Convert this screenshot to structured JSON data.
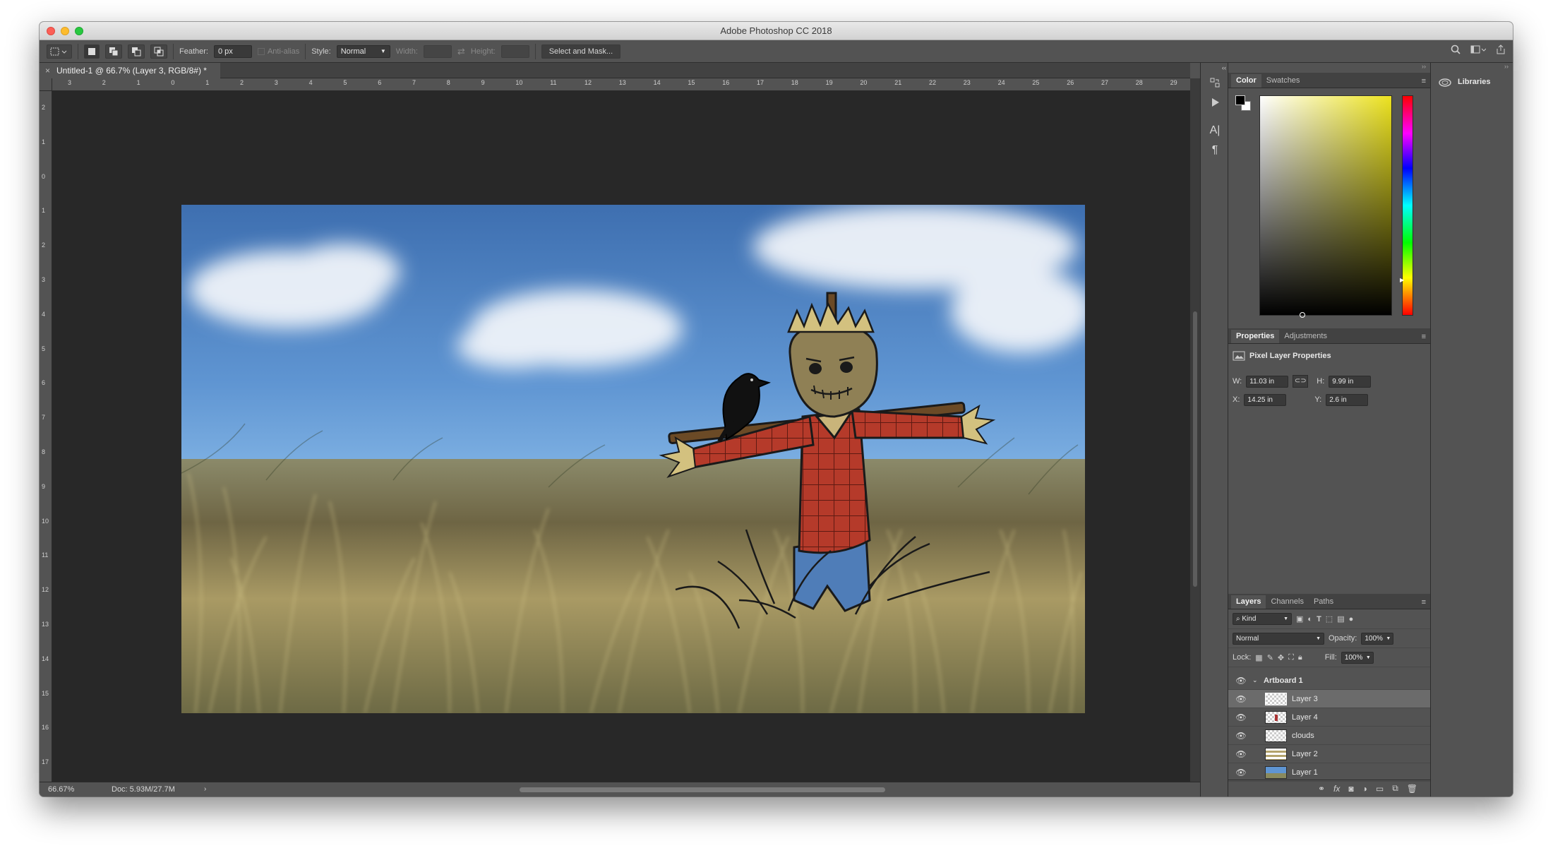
{
  "app": {
    "title": "Adobe Photoshop CC 2018"
  },
  "options_bar": {
    "feather_label": "Feather:",
    "feather_value": "0 px",
    "anti_alias_label": "Anti-alias",
    "style_label": "Style:",
    "style_value": "Normal",
    "width_label": "Width:",
    "height_label": "Height:",
    "select_mask_label": "Select and Mask..."
  },
  "document": {
    "tab_title": "Untitled-1 @ 66.7% (Layer 3, RGB/8#) *",
    "zoom": "66.67%",
    "doc_size": "Doc: 5.93M/27.7M"
  },
  "rulers": {
    "top": [
      "3",
      "2",
      "1",
      "0",
      "1",
      "2",
      "3",
      "4",
      "5",
      "6",
      "7",
      "8",
      "9",
      "10",
      "11",
      "12",
      "13",
      "14",
      "15",
      "16",
      "17",
      "18",
      "19",
      "20",
      "21",
      "22",
      "23",
      "24",
      "25",
      "26",
      "27",
      "28",
      "29"
    ],
    "left": [
      "2",
      "1",
      "0",
      "1",
      "2",
      "3",
      "4",
      "5",
      "6",
      "7",
      "8",
      "9",
      "10",
      "11",
      "12",
      "13",
      "14",
      "15",
      "16",
      "17"
    ]
  },
  "color_panel": {
    "tabs": [
      "Color",
      "Swatches"
    ],
    "foreground": "#000000",
    "background": "#ffffff",
    "hue_color": "#ece21f"
  },
  "properties_panel": {
    "tabs": [
      "Properties",
      "Adjustments"
    ],
    "heading": "Pixel Layer Properties",
    "w_label": "W:",
    "w_value": "11.03 in",
    "h_label": "H:",
    "h_value": "9.99 in",
    "x_label": "X:",
    "x_value": "14.25 in",
    "y_label": "Y:",
    "y_value": "2.6 in"
  },
  "layers_panel": {
    "tabs": [
      "Layers",
      "Channels",
      "Paths"
    ],
    "filter_value": "Kind",
    "blend_mode": "Normal",
    "opacity_label": "Opacity:",
    "opacity_value": "100%",
    "lock_label": "Lock:",
    "fill_label": "Fill:",
    "fill_value": "100%",
    "group_name": "Artboard 1",
    "layers": [
      {
        "name": "Layer 3"
      },
      {
        "name": "Layer 4"
      },
      {
        "name": "clouds"
      },
      {
        "name": "Layer 2"
      },
      {
        "name": "Layer 1"
      }
    ]
  },
  "libraries": {
    "label": "Libraries"
  }
}
